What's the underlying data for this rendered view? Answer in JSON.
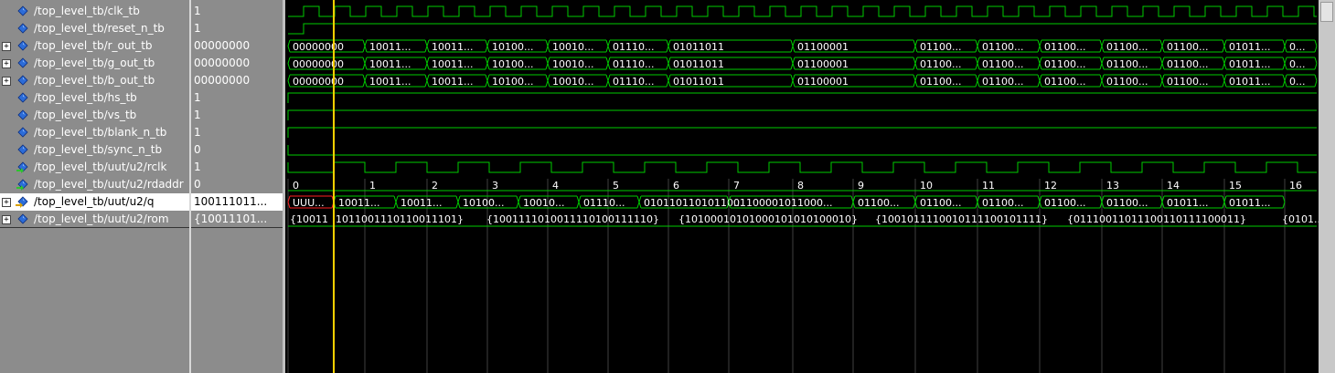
{
  "signals": [
    {
      "name": "/top_level_tb/clk_tb",
      "value": "1",
      "icon": "diamond-icon",
      "expandable": false
    },
    {
      "name": "/top_level_tb/reset_n_tb",
      "value": "1",
      "icon": "diamond-icon",
      "expandable": false
    },
    {
      "name": "/top_level_tb/r_out_tb",
      "value": "00000000",
      "icon": "diamond-icon",
      "expandable": true
    },
    {
      "name": "/top_level_tb/g_out_tb",
      "value": "00000000",
      "icon": "diamond-icon",
      "expandable": true
    },
    {
      "name": "/top_level_tb/b_out_tb",
      "value": "00000000",
      "icon": "diamond-icon",
      "expandable": true
    },
    {
      "name": "/top_level_tb/hs_tb",
      "value": "1",
      "icon": "diamond-icon",
      "expandable": false
    },
    {
      "name": "/top_level_tb/vs_tb",
      "value": "1",
      "icon": "diamond-icon",
      "expandable": false
    },
    {
      "name": "/top_level_tb/blank_n_tb",
      "value": "1",
      "icon": "diamond-icon",
      "expandable": false
    },
    {
      "name": "/top_level_tb/sync_n_tb",
      "value": "0",
      "icon": "diamond-icon",
      "expandable": false
    },
    {
      "name": "/top_level_tb/uut/u2/rclk",
      "value": "1",
      "icon": "input-diamond-icon",
      "expandable": false
    },
    {
      "name": "/top_level_tb/uut/u2/rdaddr",
      "value": "0",
      "icon": "input-diamond-icon",
      "expandable": false
    },
    {
      "name": "/top_level_tb/uut/u2/q",
      "value": "100111011...",
      "icon": "output-diamond-icon",
      "expandable": true,
      "selected": true
    },
    {
      "name": "/top_level_tb/uut/u2/rom",
      "value": "{10011101...",
      "icon": "diamond-icon",
      "expandable": true
    }
  ],
  "waves": {
    "rgb_segments": [
      "00000000",
      "10011...",
      "10011...",
      "10100...",
      "10010...",
      "01110...",
      "01011011",
      "01100001",
      "01100...",
      "01100...",
      "01100...",
      "01100...",
      "01100...",
      "01011...",
      "0..."
    ],
    "rdaddr_labels": [
      "0",
      "1",
      "2",
      "3",
      "4",
      "5",
      "6",
      "7",
      "8",
      "9",
      "10",
      "11",
      "12",
      "13",
      "14",
      "15",
      "16"
    ],
    "q_segments": [
      "UUU...",
      "10011...",
      "10011...",
      "10100...",
      "10010...",
      "01110...",
      "01011011010110...",
      "01100001011000...",
      "01100...",
      "01100...",
      "01100...",
      "01100...",
      "01100...",
      "01011...",
      "01011..."
    ],
    "rom_segments": [
      "{10011",
      "1011001110110011101}",
      "{1001111010011110100111110}",
      "{10100010101000101010100010}",
      "{1001011110010111100101111}",
      "{01110011011100110111100011}",
      "{0101..."
    ],
    "colors": {
      "wave": "#00cc00",
      "cursor": "#ffd000",
      "grid": "#404040",
      "undefined": "#ff2020",
      "text": "#ffffff"
    }
  }
}
